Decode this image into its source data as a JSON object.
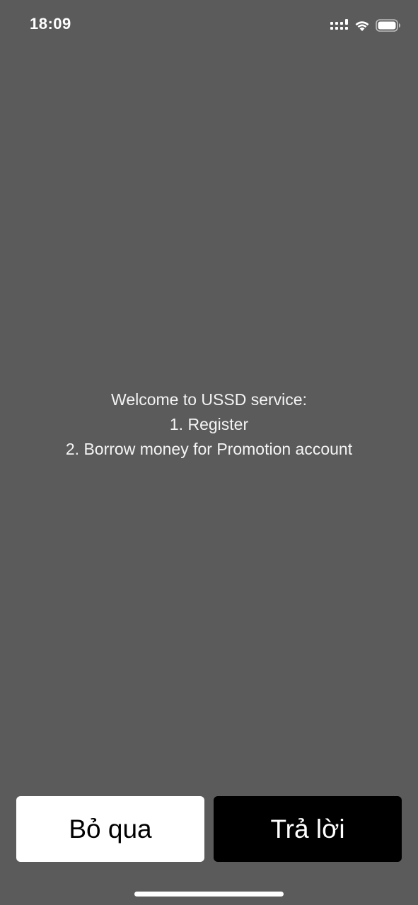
{
  "status_bar": {
    "time": "18:09",
    "icons": [
      "cellular-signal-icon",
      "wifi-icon",
      "battery-icon"
    ]
  },
  "ussd_dialog": {
    "lines": [
      "Welcome to USSD service:",
      "1. Register",
      "2. Borrow money for Promotion account"
    ]
  },
  "actions": {
    "dismiss_label": "Bỏ qua",
    "reply_label": "Trả lời"
  },
  "colors": {
    "background": "#5b5b5b",
    "dismiss_bg": "#ffffff",
    "reply_bg": "#000000",
    "text": "#ffffff"
  }
}
